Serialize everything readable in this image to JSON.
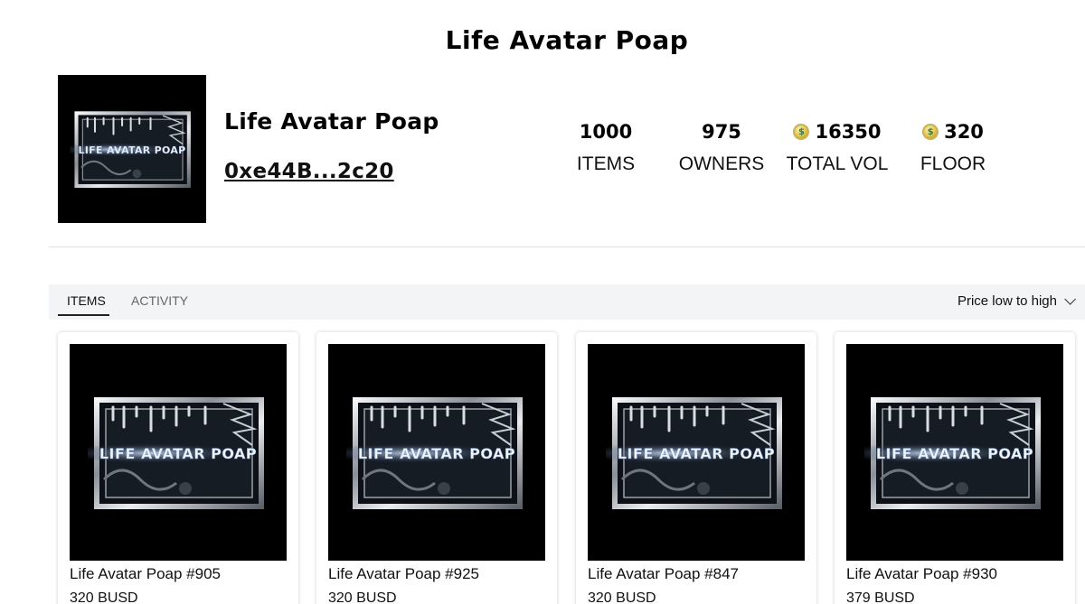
{
  "page": {
    "title": "Life Avatar Poap"
  },
  "collection": {
    "name": "Life Avatar Poap",
    "contract": "0xe44B...2c20",
    "logo_text": "LIFE AVATAR POAP"
  },
  "stats": [
    {
      "value": "1000",
      "label": "ITEMS",
      "icon": ""
    },
    {
      "value": "975",
      "label": "OWNERS",
      "icon": ""
    },
    {
      "value": "16350",
      "label": "TOTAL VOL",
      "icon": "coin-icon"
    },
    {
      "value": "320",
      "label": "FLOOR",
      "icon": "coin-icon"
    }
  ],
  "tabs": [
    {
      "label": "ITEMS",
      "active": true
    },
    {
      "label": "ACTIVITY",
      "active": false
    }
  ],
  "sort": {
    "selected": "Price low to high"
  },
  "items": [
    {
      "name": "Life Avatar Poap #905",
      "price": "320 BUSD"
    },
    {
      "name": "Life Avatar Poap #925",
      "price": "320 BUSD"
    },
    {
      "name": "Life Avatar Poap #847",
      "price": "320 BUSD"
    },
    {
      "name": "Life Avatar Poap #930",
      "price": "379 BUSD"
    }
  ],
  "colors": {
    "background": "#ffffff",
    "tabbar": "#f3f4f6",
    "coin": "#e6c44a"
  }
}
